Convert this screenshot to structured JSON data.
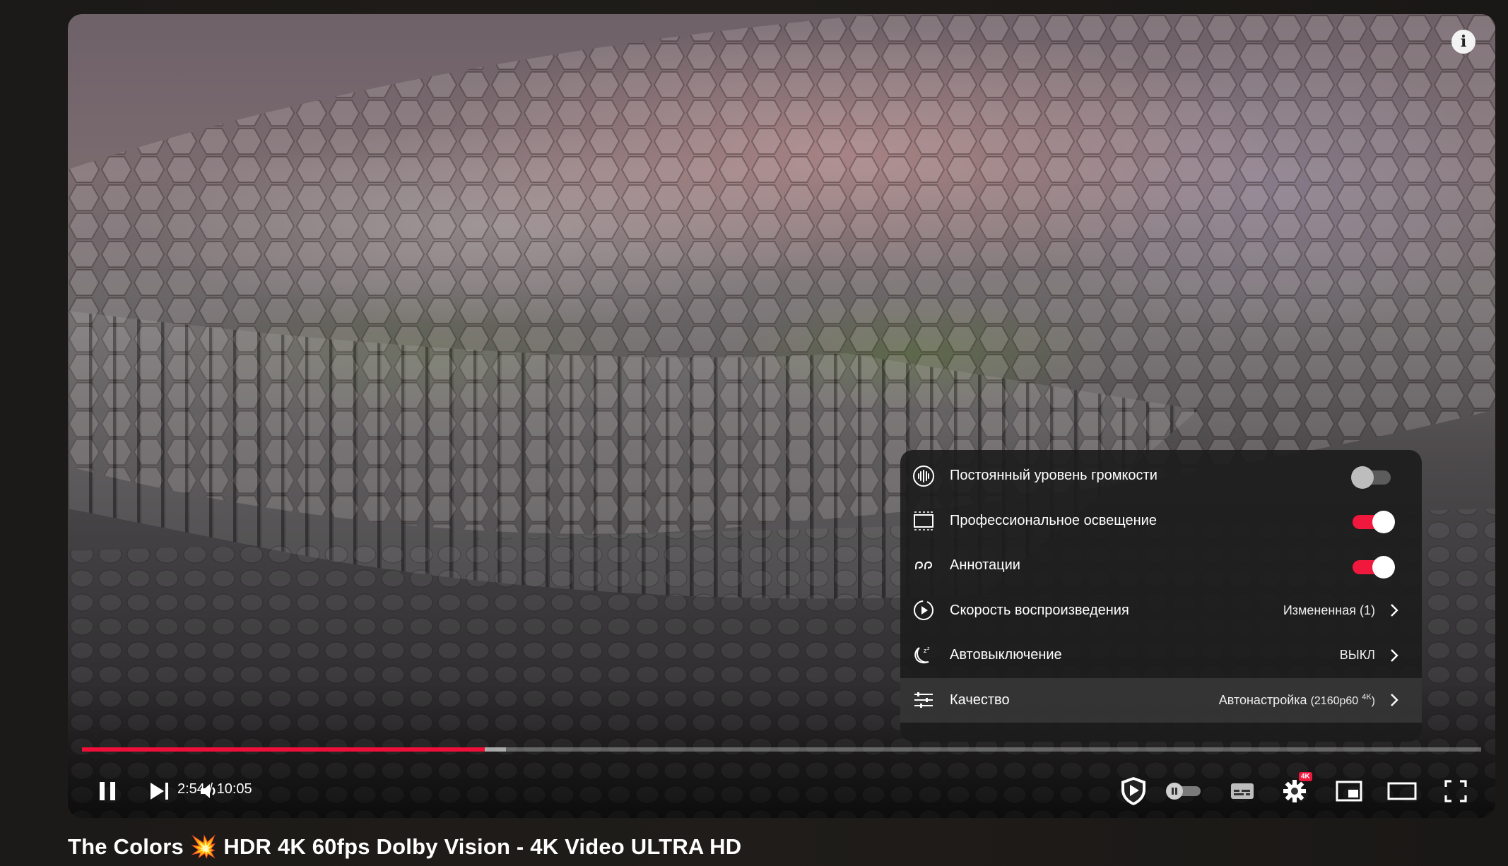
{
  "video": {
    "title": "The Colors 💥 HDR 4K 60fps Dolby Vision - 4K Video ULTRA HD",
    "current_time": "2:54",
    "duration": "10:05",
    "time_display": "2:54 / 10:05",
    "progress_fraction": 0.288,
    "buffered_fraction": 0.303
  },
  "settings_menu": {
    "items": [
      {
        "icon": "volume-level-icon",
        "label": "Постоянный уровень громкости",
        "type": "toggle",
        "on": false
      },
      {
        "icon": "ambient-mode-icon",
        "label": "Профессиональное освещение",
        "type": "toggle",
        "on": true
      },
      {
        "icon": "annotations-icon",
        "label": "Аннотации",
        "type": "toggle",
        "on": true
      },
      {
        "icon": "playback-speed-icon",
        "label": "Скорость воспроизведения",
        "type": "submenu",
        "value": "Измененная (1)"
      },
      {
        "icon": "sleep-timer-icon",
        "label": "Автовыключение",
        "type": "submenu",
        "value": "ВЫКЛ"
      },
      {
        "icon": "quality-icon",
        "label": "Качество",
        "type": "submenu",
        "value": "Автонастройка",
        "value_sub": "(2160p60",
        "value_sup": "4K",
        "value_end": ")"
      }
    ]
  },
  "controls": {
    "quality_badge": "4K"
  },
  "colors": {
    "accent": "#f0183c",
    "menu_bg": "#1c1c1c"
  }
}
